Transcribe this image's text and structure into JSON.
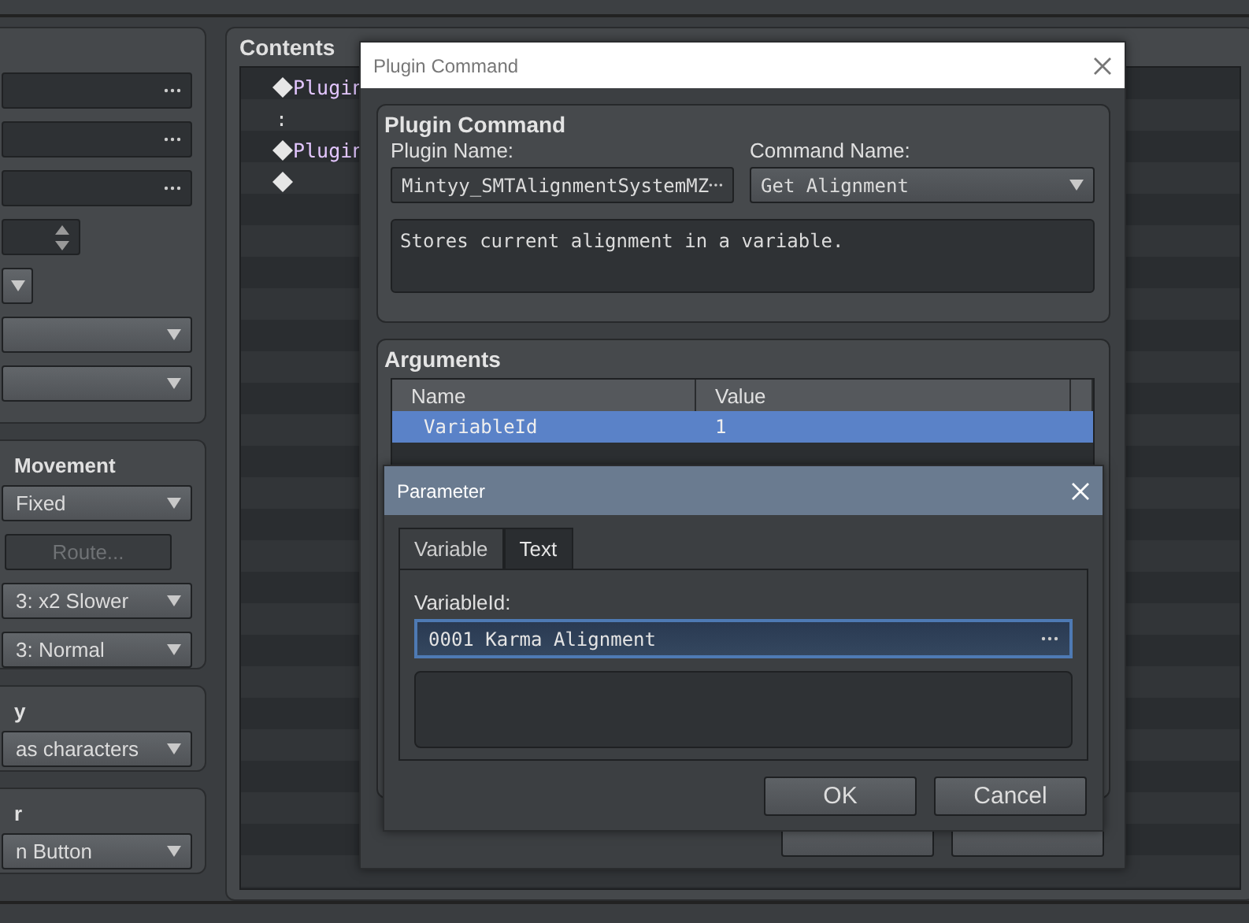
{
  "left_panel": {
    "groups": [
      {
        "fields": [
          {
            "kind": "picker"
          },
          {
            "kind": "picker"
          },
          {
            "kind": "picker"
          },
          {
            "kind": "spin"
          },
          {
            "kind": "small-select"
          },
          {
            "kind": "select"
          },
          {
            "kind": "select"
          }
        ]
      },
      {
        "title": "Movement",
        "fields": [
          {
            "kind": "select",
            "text": "Fixed"
          },
          {
            "kind": "button",
            "text": "Route...",
            "disabled": true
          },
          {
            "kind": "select",
            "text": "3: x2 Slower"
          },
          {
            "kind": "select",
            "text": "3: Normal"
          }
        ]
      },
      {
        "title": "y",
        "fields": [
          {
            "kind": "select",
            "text": "as characters"
          }
        ]
      },
      {
        "title": "r",
        "fields": [
          {
            "kind": "select",
            "text": "n Button"
          }
        ]
      }
    ]
  },
  "contents": {
    "title": "Contents",
    "lines": [
      {
        "kind": "command",
        "text": "Plugin"
      },
      {
        "kind": "continuation",
        "text": ":"
      },
      {
        "kind": "command",
        "text": "Plugin"
      },
      {
        "kind": "end"
      }
    ]
  },
  "plugin_dialog": {
    "title": "Plugin Command",
    "group_title": "Plugin Command",
    "plugin_name_label": "Plugin Name:",
    "plugin_name": "Mintyy_SMTAlignmentSystemMZ",
    "command_name_label": "Command Name:",
    "command_name": "Get Alignment",
    "description": "Stores current alignment in a variable.",
    "arguments_title": "Arguments",
    "columns": [
      "Name",
      "Value"
    ],
    "rows": [
      {
        "name": "VariableId",
        "value": "1",
        "selected": true
      }
    ]
  },
  "parameter_dialog": {
    "title": "Parameter",
    "tabs": [
      {
        "label": "Variable",
        "selected": true
      },
      {
        "label": "Text",
        "selected": false
      }
    ],
    "field_label": "VariableId:",
    "field_value": "0001 Karma Alignment",
    "buttons": [
      "OK",
      "Cancel"
    ]
  }
}
